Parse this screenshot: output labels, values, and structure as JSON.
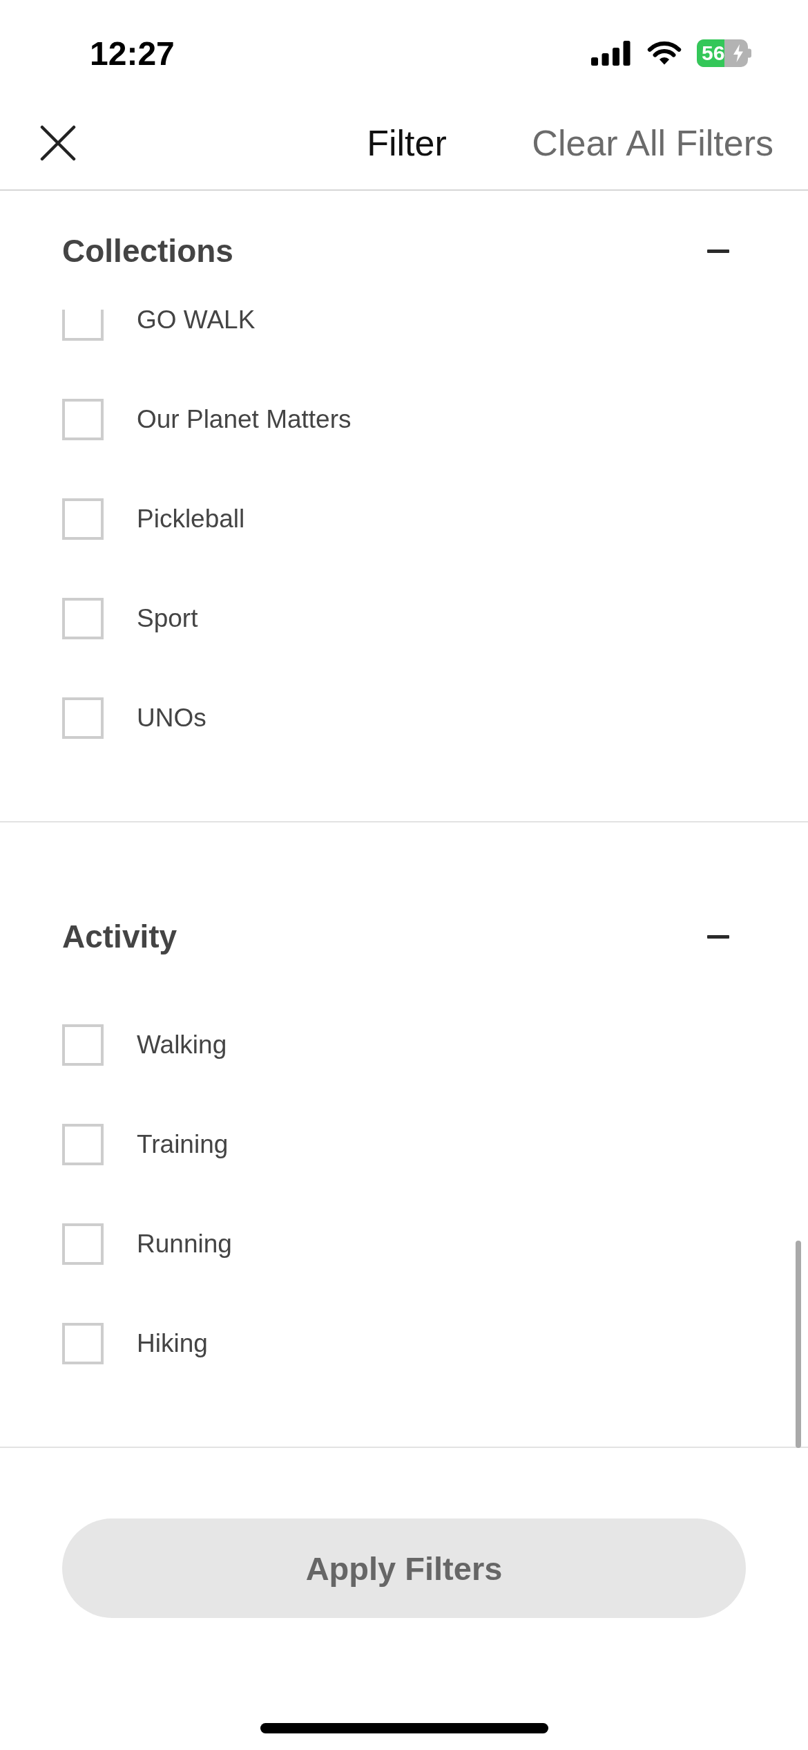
{
  "status_bar": {
    "time": "12:27",
    "battery": "56",
    "charging": true
  },
  "header": {
    "title": "Filter",
    "clear_button": "Clear All Filters"
  },
  "sections": [
    {
      "title": "Collections",
      "expanded": true,
      "options": [
        {
          "label": "GO WALK",
          "checked": false
        },
        {
          "label": "Our Planet Matters",
          "checked": false
        },
        {
          "label": "Pickleball",
          "checked": false
        },
        {
          "label": "Sport",
          "checked": false
        },
        {
          "label": "UNOs",
          "checked": false
        }
      ]
    },
    {
      "title": "Activity",
      "expanded": true,
      "options": [
        {
          "label": "Walking",
          "checked": false
        },
        {
          "label": "Training",
          "checked": false
        },
        {
          "label": "Running",
          "checked": false
        },
        {
          "label": "Hiking",
          "checked": false
        }
      ]
    }
  ],
  "apply_button": {
    "label": "Apply Filters",
    "disabled": true
  }
}
